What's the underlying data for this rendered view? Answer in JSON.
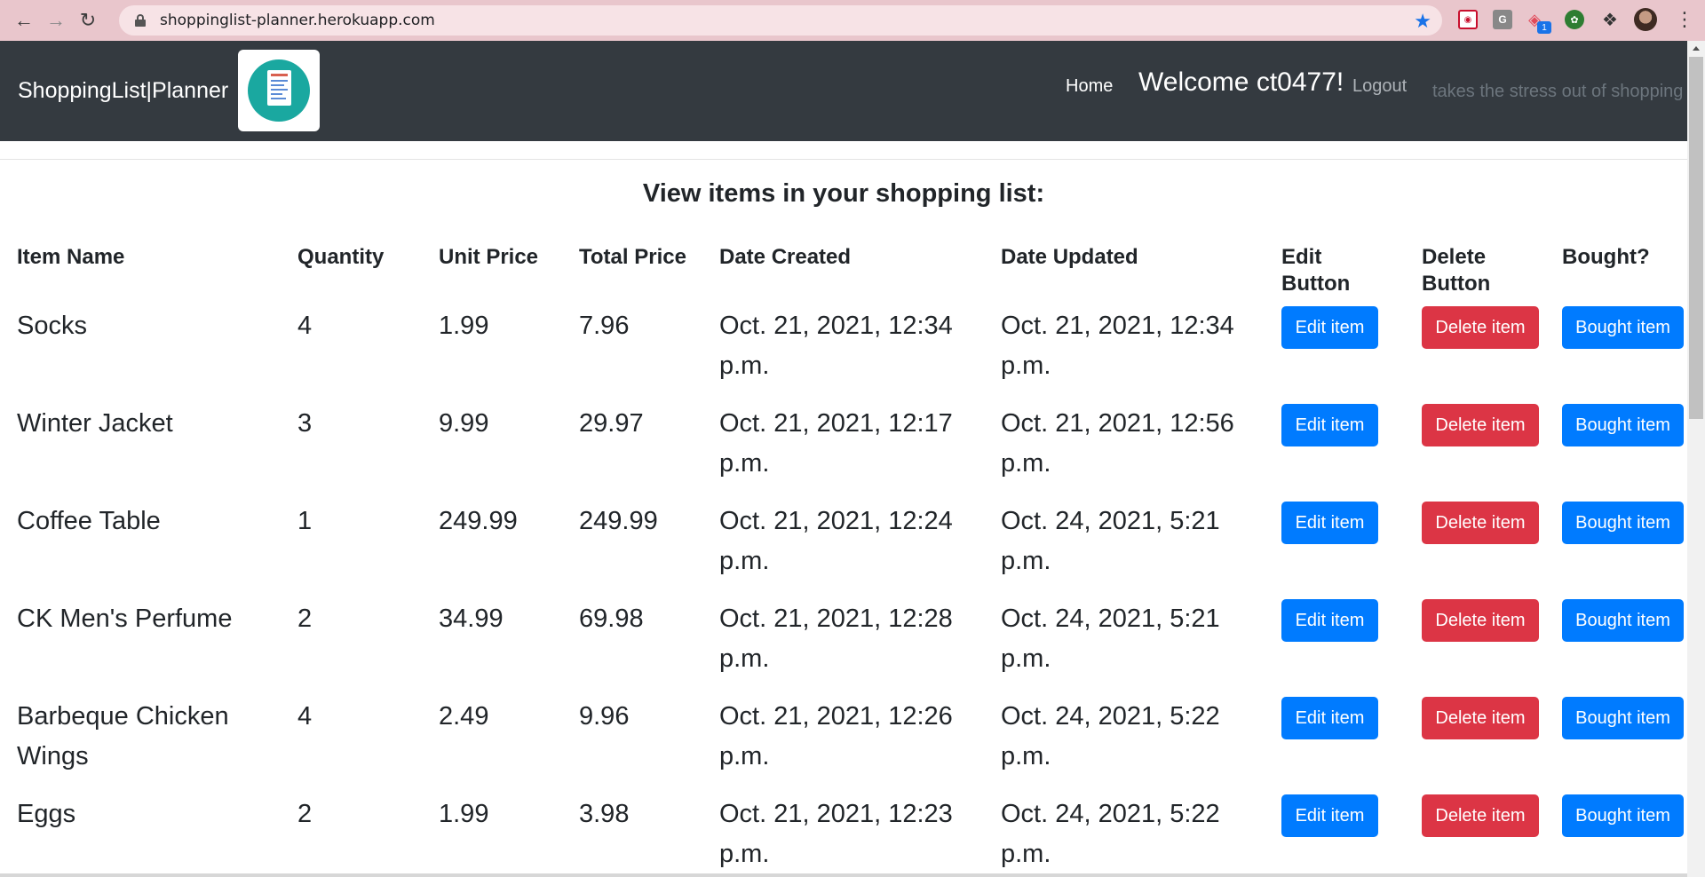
{
  "browser": {
    "url": "shoppinglist-planner.herokuapp.com",
    "extension_badge": "1"
  },
  "navbar": {
    "brand": "ShoppingList|Planner",
    "home": "Home",
    "welcome": "Welcome ct0477!",
    "logout": "Logout",
    "tagline": "takes the stress out of shopping"
  },
  "page": {
    "title": "View items in your shopping list:"
  },
  "table": {
    "headers": [
      "Item Name",
      "Quantity",
      "Unit Price",
      "Total Price",
      "Date Created",
      "Date Updated",
      "Edit Button",
      "Delete Button",
      "Bought?"
    ],
    "rows": [
      {
        "name_l1": "Socks",
        "name_l2": "",
        "qty": "4",
        "unit": "1.99",
        "total": "7.96",
        "created_l1": "Oct. 21, 2021, 12:34",
        "created_l2": "p.m.",
        "updated_l1": "Oct. 21, 2021, 12:34",
        "updated_l2": "p.m."
      },
      {
        "name_l1": "Winter Jacket",
        "name_l2": "",
        "qty": "3",
        "unit": "9.99",
        "total": "29.97",
        "created_l1": "Oct. 21, 2021, 12:17",
        "created_l2": "p.m.",
        "updated_l1": "Oct. 21, 2021, 12:56",
        "updated_l2": "p.m."
      },
      {
        "name_l1": "Coffee Table",
        "name_l2": "",
        "qty": "1",
        "unit": "249.99",
        "total": "249.99",
        "created_l1": "Oct. 21, 2021, 12:24",
        "created_l2": "p.m.",
        "updated_l1": "Oct. 24, 2021, 5:21",
        "updated_l2": "p.m."
      },
      {
        "name_l1": "CK Men's Perfume",
        "name_l2": "",
        "qty": "2",
        "unit": "34.99",
        "total": "69.98",
        "created_l1": "Oct. 21, 2021, 12:28",
        "created_l2": "p.m.",
        "updated_l1": "Oct. 24, 2021, 5:21",
        "updated_l2": "p.m."
      },
      {
        "name_l1": "Barbeque Chicken",
        "name_l2": "Wings",
        "qty": "4",
        "unit": "2.49",
        "total": "9.96",
        "created_l1": "Oct. 21, 2021, 12:26",
        "created_l2": "p.m.",
        "updated_l1": "Oct. 24, 2021, 5:22",
        "updated_l2": "p.m."
      },
      {
        "name_l1": "Eggs",
        "name_l2": "",
        "qty": "2",
        "unit": "1.99",
        "total": "3.98",
        "created_l1": "Oct. 21, 2021, 12:23",
        "created_l2": "p.m.",
        "updated_l1": "Oct. 24, 2021, 5:22",
        "updated_l2": "p.m."
      }
    ],
    "buttons": {
      "edit": "Edit item",
      "delete": "Delete item",
      "bought": "Bought item"
    }
  },
  "colors": {
    "navbar": "#343a40",
    "primary": "#007bff",
    "danger": "#dc3545",
    "chrome": "#e9c6cc"
  }
}
